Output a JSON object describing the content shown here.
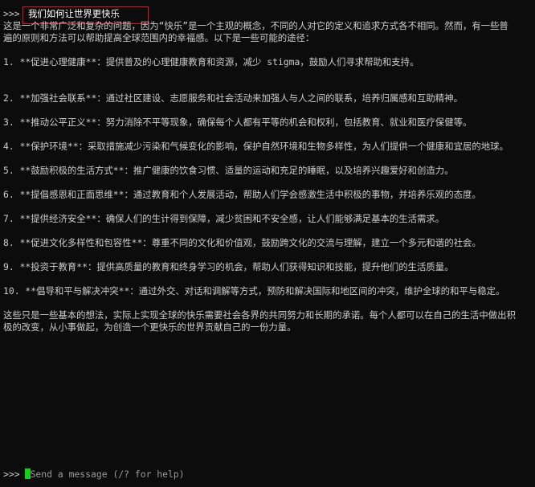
{
  "prompt_symbol": ">>>",
  "user_query": "我们如何让世界更快乐",
  "intro": "这是一个非常广泛和复杂的问题，因为“快乐”是一个主观的概念，不同的人对它的定义和追求方式各不相同。然而，有一些普遍的原则和方法可以帮助提高全球范围内的幸福感。以下是一些可能的途径：",
  "items": [
    "1. **促进心理健康**：提供普及的心理健康教育和资源，减少 stigma，鼓励人们寻求帮助和支持。",
    "2. **加强社会联系**：通过社区建设、志愿服务和社会活动来加强人与人之间的联系，培养归属感和互助精神。",
    "3. **推动公平正义**：努力消除不平等现象，确保每个人都有平等的机会和权利，包括教育、就业和医疗保健等。",
    "4. **保护环境**：采取措施减少污染和气候变化的影响，保护自然环境和生物多样性，为人们提供一个健康和宜居的地球。",
    "5. **鼓励积极的生活方式**：推广健康的饮食习惯、适量的运动和充足的睡眠，以及培养兴趣爱好和创造力。",
    "6. **提倡感恩和正面思维**：通过教育和个人发展活动，帮助人们学会感激生活中积极的事物，并培养乐观的态度。",
    "7. **提供经济安全**：确保人们的生计得到保障，减少贫困和不安全感，让人们能够满足基本的生活需求。",
    "8. **促进文化多样性和包容性**：尊重不同的文化和价值观，鼓励跨文化的交流与理解，建立一个多元和谐的社会。",
    "9. **投资于教育**：提供高质量的教育和终身学习的机会，帮助人们获得知识和技能，提升他们的生活质量。",
    "10. **倡导和平与解决冲突**：通过外交、对话和调解等方式，预防和解决国际和地区间的冲突，维护全球的和平与稳定。"
  ],
  "conclusion": "这些只是一些基本的想法，实际上实现全球的快乐需要社会各界的共同努力和长期的承诺。每个人都可以在自己的生活中做出积极的改变，从小事做起，为创造一个更快乐的世界贡献自己的一份力量。",
  "input": {
    "placeholder": "Send a message (/? for help)"
  },
  "colors": {
    "background": "#0c0c0c",
    "text": "#cccccc",
    "cursor": "#11d21a",
    "highlight_border": "#e0141e"
  }
}
